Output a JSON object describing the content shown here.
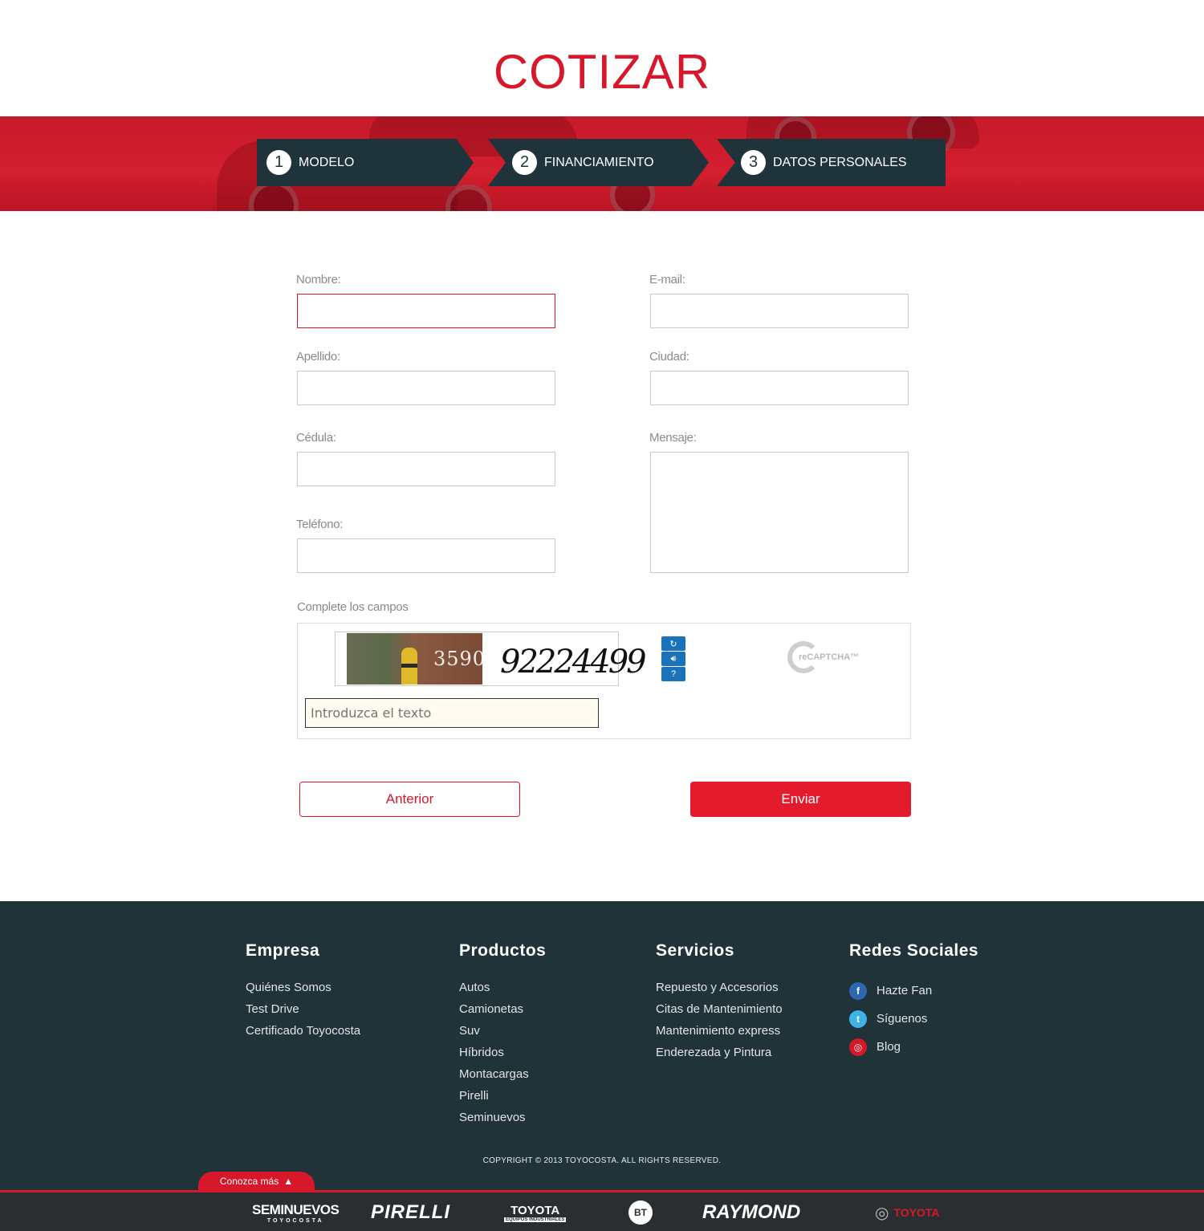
{
  "page": {
    "title": "COTIZAR"
  },
  "steps": [
    {
      "number": "1",
      "label": "MODELO"
    },
    {
      "number": "2",
      "label": "FINANCIAMIENTO"
    },
    {
      "number": "3",
      "label": "DATOS PERSONALES"
    }
  ],
  "form": {
    "nombre_label": "Nombre:",
    "apellido_label": "Apellido:",
    "cedula_label": "Cédula:",
    "telefono_label": "Teléfono:",
    "email_label": "E-mail:",
    "ciudad_label": "Ciudad:",
    "mensaje_label": "Mensaje:",
    "complete_note": "Complete los campos"
  },
  "captcha": {
    "photo_number": "3590",
    "word": "92224499",
    "input_placeholder": "Introduzca el texto",
    "logo_text": "reCAPTCHA™"
  },
  "buttons": {
    "prev": "Anterior",
    "send": "Enviar"
  },
  "footer": {
    "empresa": {
      "title": "Empresa",
      "links": [
        "Quiénes Somos",
        "Test Drive",
        "Certificado Toyocosta"
      ]
    },
    "productos": {
      "title": "Productos",
      "links": [
        "Autos",
        "Camionetas",
        "Suv",
        "Híbridos",
        "Montacargas",
        "Pirelli",
        "Seminuevos"
      ]
    },
    "servicios": {
      "title": "Servicios",
      "links": [
        "Repuesto y Accesorios",
        "Citas de Mantenimiento",
        "Mantenimiento express",
        "Enderezada y Pintura"
      ]
    },
    "redes": {
      "title": "Redes Sociales",
      "items": [
        {
          "label": "Hazte Fan",
          "icon": "facebook-icon",
          "color": "#2d67b0"
        },
        {
          "label": "Síguenos",
          "icon": "twitter-icon",
          "color": "#3eb4e6"
        },
        {
          "label": "Blog",
          "icon": "toyota-blog-icon",
          "color": "#d7182a"
        }
      ]
    },
    "copyright": "COPYRIGHT © 2013 TOYOCOSTA. ALL RIGHTS RESERVED.",
    "more_tab": "Conozca más",
    "brands": [
      "SEMINUEVOS",
      "TOYOCOSTA",
      "PIRELLI",
      "TOYOTA",
      "EQUIPOS INDUSTRIALES",
      "BT",
      "RAYMOND",
      "TOYOTA"
    ]
  },
  "colors": {
    "brand_red": "#d7182a",
    "dark": "#1f343a"
  }
}
